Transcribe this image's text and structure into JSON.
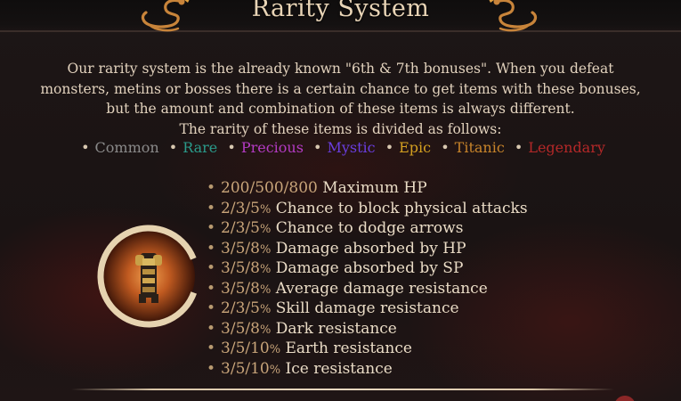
{
  "header": {
    "title": "Rarity System"
  },
  "intro": {
    "lines": [
      "Our rarity system is the already known \"6th & 7th bonuses\". When you defeat",
      "monsters, metins or bosses there is a certain chance to get items with these bonuses,",
      "but the amount and combination of these items is always different.",
      "The rarity of these items is divided as follows:"
    ]
  },
  "rarities": [
    {
      "label": "Common",
      "color": "#8a8a8a"
    },
    {
      "label": "Rare",
      "color": "#2a9a8a"
    },
    {
      "label": "Precious",
      "color": "#b43bc4"
    },
    {
      "label": "Mystic",
      "color": "#6a3ee0"
    },
    {
      "label": "Epic",
      "color": "#d4a020"
    },
    {
      "label": "Titanic",
      "color": "#c8842a"
    },
    {
      "label": "Legendary",
      "color": "#b42828"
    }
  ],
  "bonuses": [
    {
      "value": "200/500/800",
      "unit": "",
      "text": "Maximum HP"
    },
    {
      "value": "2/3/5",
      "unit": "%",
      "text": "Chance to block physical attacks"
    },
    {
      "value": "2/3/5",
      "unit": "%",
      "text": "Chance to dodge arrows"
    },
    {
      "value": "3/5/8",
      "unit": "%",
      "text": "Damage absorbed by HP"
    },
    {
      "value": "3/5/8",
      "unit": "%",
      "text": "Damage absorbed by SP"
    },
    {
      "value": "3/5/8",
      "unit": "%",
      "text": "Average damage resistance"
    },
    {
      "value": "2/3/5",
      "unit": "%",
      "text": "Skill damage resistance"
    },
    {
      "value": "3/5/8",
      "unit": "%",
      "text": "Dark resistance"
    },
    {
      "value": "3/5/10",
      "unit": "%",
      "text": "Earth resistance"
    },
    {
      "value": "3/5/10",
      "unit": "%",
      "text": "Ice resistance"
    }
  ],
  "icons": {
    "dragon_left": "dragon-ornament-icon",
    "dragon_right": "dragon-ornament-icon",
    "armor": "armor-item-icon"
  }
}
